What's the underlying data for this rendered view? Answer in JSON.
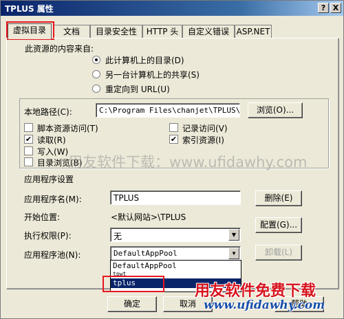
{
  "window": {
    "title": "TPLUS 属性",
    "help_label": "?",
    "close_label": "X"
  },
  "tabs": [
    {
      "label": "虚拟目录"
    },
    {
      "label": "文档"
    },
    {
      "label": "目录安全性"
    },
    {
      "label": "HTTP 头"
    },
    {
      "label": "自定义错误"
    },
    {
      "label": "ASP.NET"
    }
  ],
  "content_source": {
    "heading": "此资源的内容来自:",
    "options": [
      {
        "label": "此计算机上的目录(D)",
        "selected": true
      },
      {
        "label": "另一台计算机上的共享(S)",
        "selected": false
      },
      {
        "label": "重定向到 URL(U)",
        "selected": false
      }
    ]
  },
  "local_path": {
    "label": "本地路径(C):",
    "value": "C:\\Program Files\\chanjet\\TPLUS\\we",
    "browse_label": "浏览(O)..."
  },
  "permissions": {
    "script_source_access": {
      "label": "脚本资源访问(T)",
      "checked": false
    },
    "read": {
      "label": "读取(R)",
      "checked": true
    },
    "write": {
      "label": "写入(W)",
      "checked": false
    },
    "directory_browsing": {
      "label": "目录浏览(B)",
      "checked": false
    },
    "log_visits": {
      "label": "记录访问(V)",
      "checked": false
    },
    "index_resource": {
      "label": "索引资源(I)",
      "checked": true
    }
  },
  "app_settings": {
    "heading": "应用程序设置",
    "app_name_label": "应用程序名(M):",
    "app_name_value": "TPLUS",
    "remove_label": "删除(E)",
    "start_point_label": "开始位置:",
    "start_point_value": "<默认网站>\\TPLUS",
    "config_label": "配置(G)...",
    "exec_perm_label": "执行权限(P):",
    "exec_perm_value": "无",
    "app_pool_label": "应用程序池(N):",
    "app_pool_value": "DefaultAppPool",
    "unload_label": "卸载(L)"
  },
  "app_pool_dropdown": {
    "options": [
      "DefaultAppPool",
      "tpwt",
      "tplus"
    ],
    "selected": "tplus"
  },
  "footer": {
    "ok_label": "确定",
    "cancel_label": "取消",
    "help_label": "帮助"
  },
  "watermark": {
    "text": "用友软件下载：www.ufidawhy.com"
  },
  "brand": {
    "title": "用友软件免费下载",
    "url": "www.ufidawhy.com"
  },
  "colors": {
    "title_bar": "#0a246a",
    "highlight": "#e8141e",
    "brand_red": "#d7131c",
    "brand_blue": "#1a4fa8"
  }
}
